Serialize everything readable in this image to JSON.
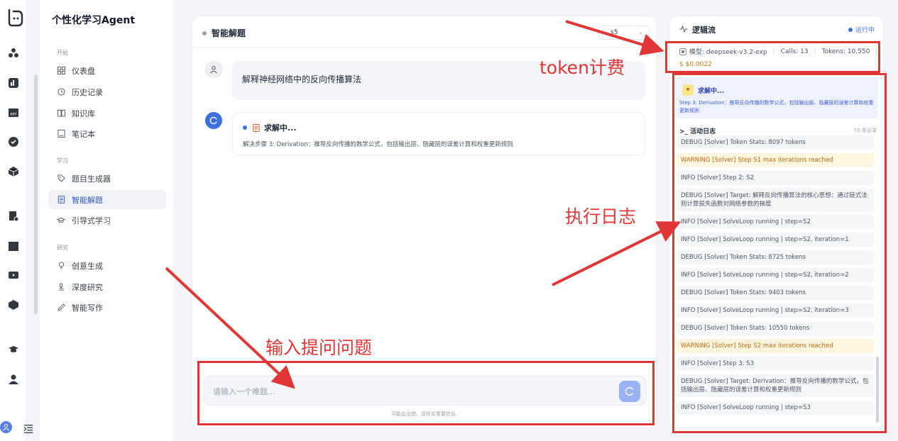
{
  "app": {
    "title": "个性化学习Agent"
  },
  "rail": {
    "icons": [
      "logo-icon",
      "molecules-icon",
      "powerbi-icon",
      "ppt-icon",
      "check-icon",
      "cube-icon",
      "code-icon",
      "clapper-icon",
      "play-icon",
      "box-icon",
      "graduation-icon",
      "user-icon"
    ],
    "collapse_icon": "indent-icon"
  },
  "sidebar": {
    "sections": [
      {
        "label": "开始",
        "items": [
          {
            "label": "仪表盘",
            "icon": "grid-icon"
          },
          {
            "label": "历史记录",
            "icon": "history-icon"
          },
          {
            "label": "知识库",
            "icon": "book-icon"
          },
          {
            "label": "笔记本",
            "icon": "notebook-icon"
          }
        ]
      },
      {
        "label": "学习",
        "items": [
          {
            "label": "题目生成器",
            "icon": "tag-icon"
          },
          {
            "label": "智能解题",
            "icon": "doc-icon",
            "active": true
          },
          {
            "label": "引导式学习",
            "icon": "cap-icon"
          }
        ]
      },
      {
        "label": "研究",
        "items": [
          {
            "label": "创意生成",
            "icon": "bulb-icon"
          },
          {
            "label": "深度研究",
            "icon": "microscope-icon"
          },
          {
            "label": "智能写作",
            "icon": "pen-icon"
          }
        ]
      }
    ]
  },
  "chat": {
    "title": "智能解题",
    "select_value": "s5",
    "user_message": "解释神经网络中的反向传播算法",
    "bot_status": "求解中...",
    "bot_step": "解决步骤 3: Derivation：推导反向传播的数学公式，包括输出层、隐藏层的误差计算和权重更新规则",
    "input_placeholder": "请输入一个难题...",
    "disclaimer": "可能会出错，请核实重要信息."
  },
  "logic": {
    "title": "逻辑流",
    "status": "运行中",
    "model": "模型: deepseek-v3.2-exp",
    "calls": "Calls: 13",
    "tokens": "Tokens: 10,550",
    "cost": "$ $0.0022",
    "solving_title": "求解中...",
    "solving_desc": "Step 3: Derivation：推导反向传播的数学公式，包括输出层、隐藏层的误差计算和权重更新规则",
    "log_title": ">_ 活动日志",
    "log_count": "55 条记录",
    "logs": [
      {
        "text": "DEBUG [Solver] Token Stats: 8097 tokens",
        "level": "debug"
      },
      {
        "text": "WARNING [Solver] Step S1 max iterations reached",
        "level": "warn"
      },
      {
        "text": "INFO [Solver] Step 2: S2",
        "level": "info"
      },
      {
        "text": "DEBUG [Solver] Target: 解释反向传播算法的核心思想：通过链式法则计算损失函数对网络参数的梯度",
        "level": "debug"
      },
      {
        "text": "INFO [Solver] SolveLoop running | step=S2",
        "level": "info"
      },
      {
        "text": "INFO [Solver] SolveLoop running | step=S2, iteration=1",
        "level": "info"
      },
      {
        "text": "DEBUG [Solver] Token Stats: 8725 tokens",
        "level": "debug"
      },
      {
        "text": "INFO [Solver] SolveLoop running | step=S2, iteration=2",
        "level": "info"
      },
      {
        "text": "DEBUG [Solver] Token Stats: 9403 tokens",
        "level": "debug"
      },
      {
        "text": "INFO [Solver] SolveLoop running | step=S2, iteration=3",
        "level": "info"
      },
      {
        "text": "DEBUG [Solver] Token Stats: 10550 tokens",
        "level": "debug"
      },
      {
        "text": "WARNING [Solver] Step S2 max iterations reached",
        "level": "warn"
      },
      {
        "text": "INFO [Solver] Step 3: S3",
        "level": "info"
      },
      {
        "text": "DEBUG [Solver] Target: Derivation：推导反向传播的数学公式，包括输出层、隐藏层的误差计算和权重更新规则",
        "level": "debug"
      },
      {
        "text": "INFO [Solver] SolveLoop running | step=S3",
        "level": "info"
      }
    ]
  },
  "annotations": {
    "token_label": "token计费",
    "log_label": "执行日志",
    "input_label": "输入提问问题",
    "color": "#e03636"
  },
  "colors": {
    "accent": "#3b6fe3",
    "warn": "#b86a12",
    "annotation": "#e03636"
  }
}
